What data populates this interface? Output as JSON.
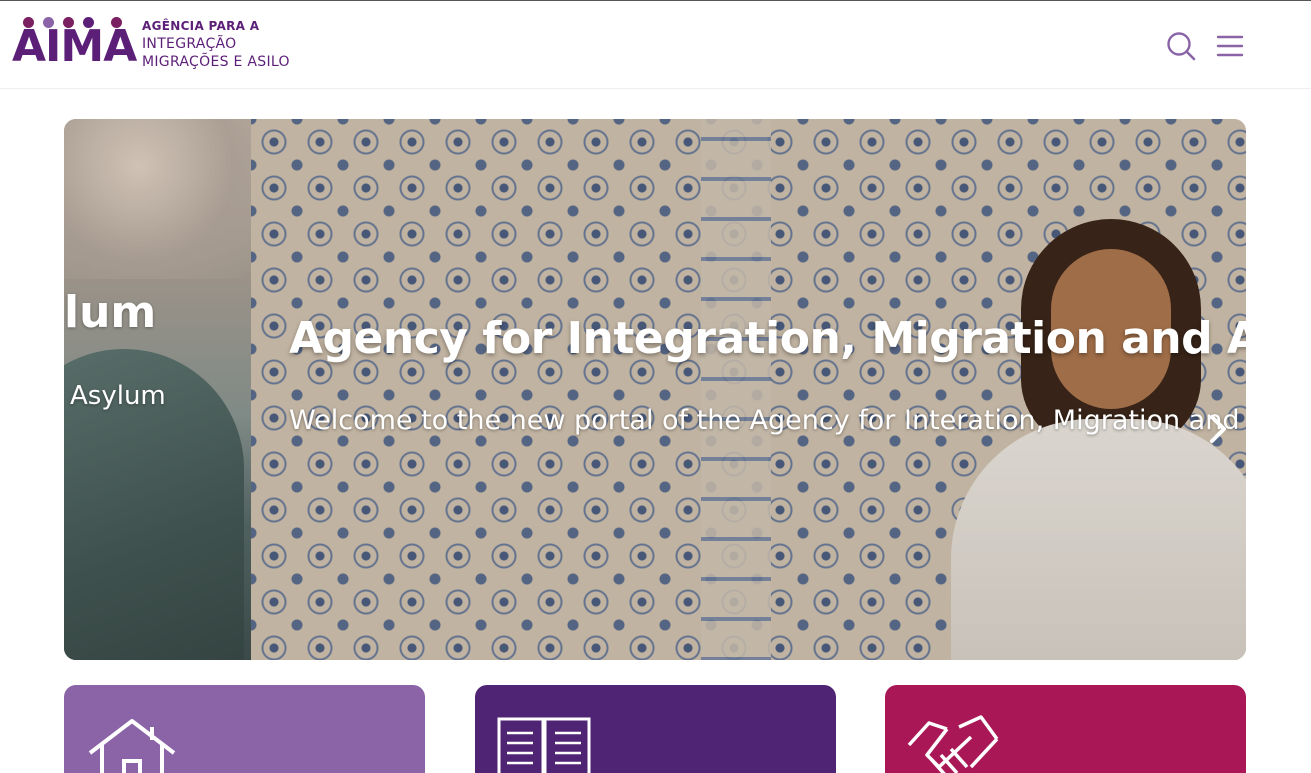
{
  "header": {
    "logo": {
      "wordmark": "AIMA",
      "line1": "AGÊNCIA PARA A",
      "line2": "INTEGRAÇÃO",
      "line3": "MIGRAÇÕES E ASILO",
      "dot_colors": [
        "#7a1f5f",
        "#8a64a6",
        "#5c1f78",
        "#502474",
        "#aa1756"
      ]
    },
    "icons": [
      "search-icon",
      "menu-icon"
    ]
  },
  "carousel": {
    "previous_slide": {
      "title": "lum",
      "subtitle": "Asylum"
    },
    "current_slide": {
      "title": "Agency for Integration, Migration and Asy",
      "subtitle": "Welcome to the new portal of the Agency for Interation, Migration and"
    },
    "next_icon": "chevron-right-icon"
  },
  "cards": [
    {
      "icon": "house-icon",
      "color": "#8a64a6"
    },
    {
      "icon": "book-icon",
      "color": "#502474"
    },
    {
      "icon": "handshake-icon",
      "color": "#aa1756"
    }
  ],
  "colors": {
    "brand_purple": "#5c1f78",
    "lavender": "#8a64a6",
    "deep_purple": "#502474",
    "magenta": "#aa1756",
    "icon_purple": "#8a64a6"
  }
}
